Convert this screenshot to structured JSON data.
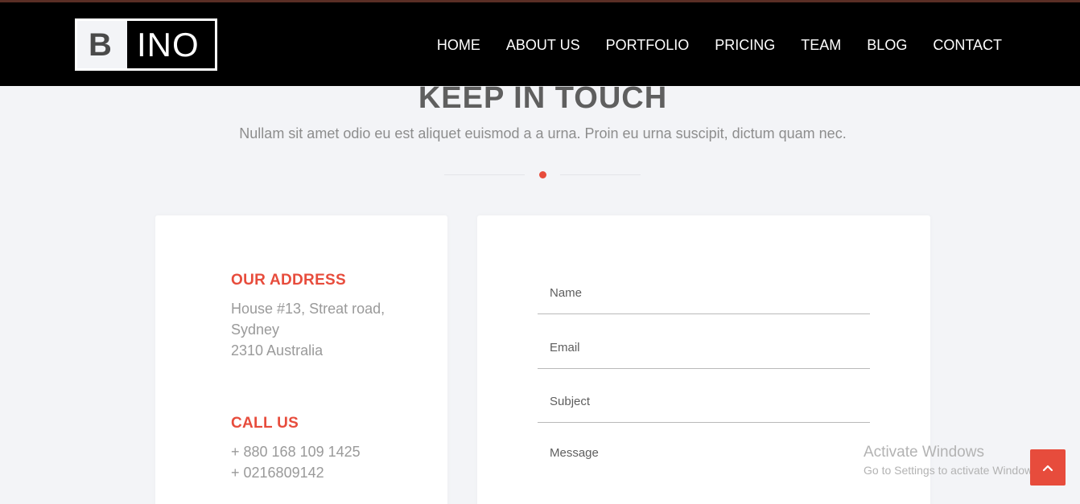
{
  "header": {
    "logo": {
      "letter": "B",
      "rest": "INO"
    },
    "nav": [
      "HOME",
      "ABOUT US",
      "PORTFOLIO",
      "PRICING",
      "TEAM",
      "BLOG",
      "CONTACT"
    ]
  },
  "section": {
    "title": "KEEP IN TOUCH",
    "subtitle": "Nullam sit amet odio eu est aliquet euismod a a urna. Proin eu urna suscipit, dictum quam nec."
  },
  "contact_info": {
    "address": {
      "title": "OUR ADDRESS",
      "lines": [
        "House #13, Streat road,",
        "Sydney",
        "2310 Australia"
      ]
    },
    "call": {
      "title": "CALL US",
      "lines": [
        "+ 880 168 109 1425",
        "+ 0216809142"
      ]
    }
  },
  "form": {
    "name_placeholder": "Name",
    "email_placeholder": "Email",
    "subject_placeholder": "Subject",
    "message_placeholder": "Message"
  },
  "watermark": {
    "title": "Activate Windows",
    "subtitle": "Go to Settings to activate Windows."
  },
  "icons": {
    "back_to_top": "chevron-up-icon"
  },
  "colors": {
    "accent": "#e74c3c",
    "header_bg": "#000000",
    "page_bg": "#f3f4f7"
  }
}
